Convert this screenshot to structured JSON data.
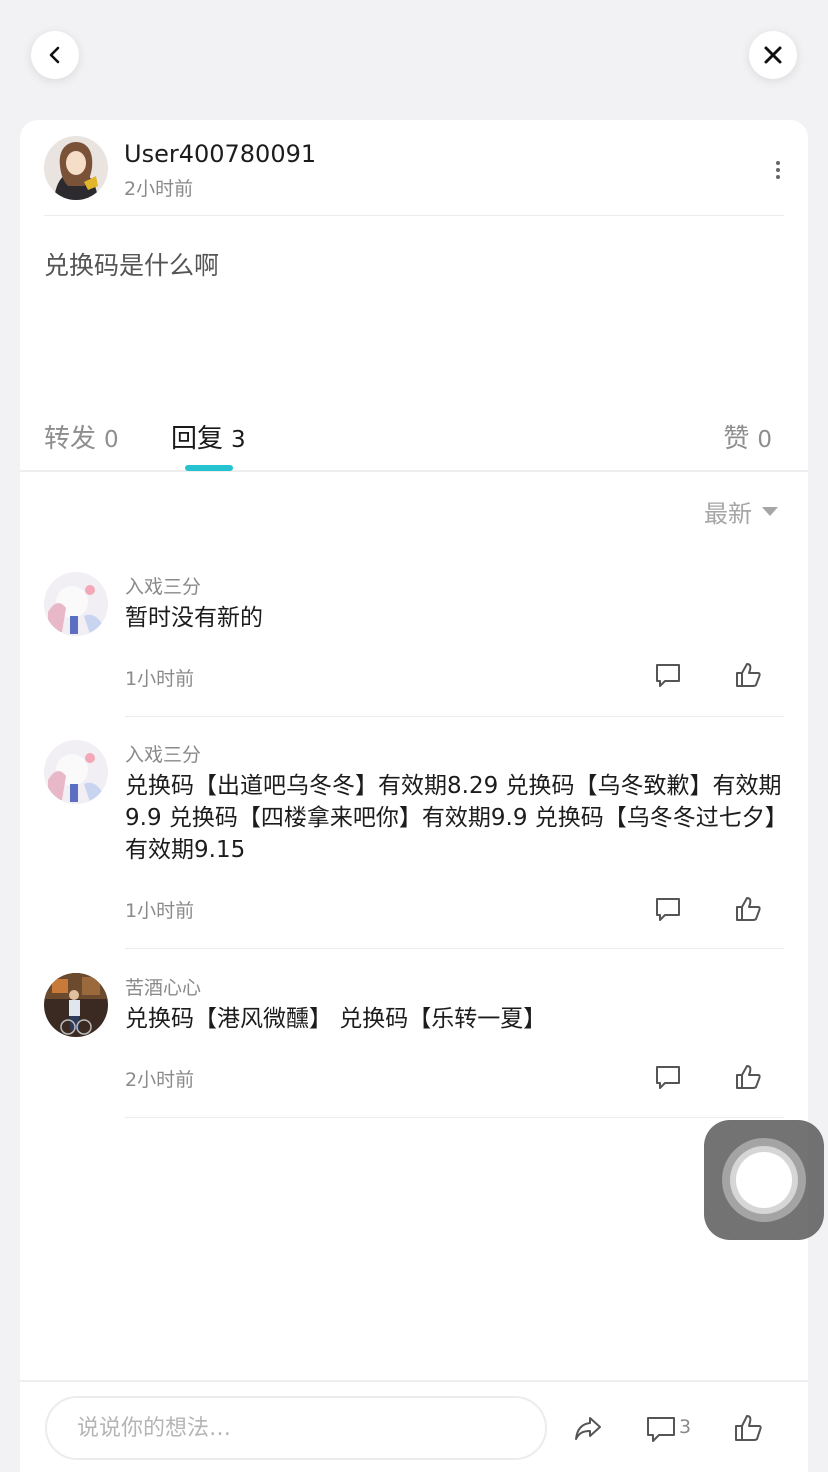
{
  "colors": {
    "accent": "#27c2d0",
    "background": "#f2f2f4",
    "card": "#ffffff",
    "muted_text": "#8a8a8a"
  },
  "nav": {
    "back_icon": "chevron-left-icon",
    "close_icon": "close-icon"
  },
  "post": {
    "username": "User400780091",
    "time": "2小时前",
    "body": "兑换码是什么啊"
  },
  "tabs": {
    "repost": {
      "label": "转发",
      "count": "0"
    },
    "reply": {
      "label": "回复",
      "count": "3"
    },
    "like": {
      "label": "赞",
      "count": "0"
    }
  },
  "sort": {
    "label": "最新"
  },
  "comments": [
    {
      "name": "入戏三分",
      "text": "暂时没有新的",
      "time": "1小时前"
    },
    {
      "name": "入戏三分",
      "text": "兑换码【出道吧乌冬冬】有效期8.29 兑换码【乌冬致歉】有效期9.9 兑换码【四楼拿来吧你】有效期9.9 兑换码【乌冬冬过七夕】有效期9.15",
      "time": "1小时前"
    },
    {
      "name": "苦酒心心",
      "text": "兑换码【港风微醺】 兑换码【乐转一夏】",
      "time": "2小时前"
    }
  ],
  "bottom_bar": {
    "placeholder": "说说你的想法…",
    "comment_count": "3",
    "icons": [
      "share-icon",
      "comment-icon",
      "thumbs-up-icon"
    ]
  }
}
